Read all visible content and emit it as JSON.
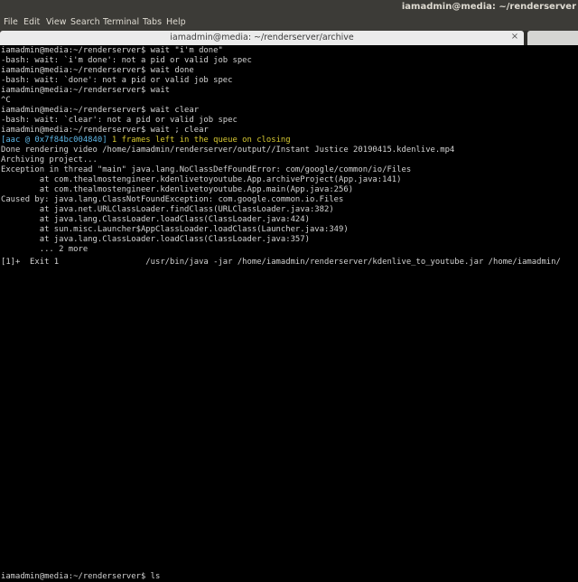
{
  "topbar": {
    "title": "iamadmin@media: ~/renderserver"
  },
  "menu": [
    "File",
    "Edit",
    "View",
    "Search",
    "Terminal",
    "Tabs",
    "Help"
  ],
  "tab": {
    "title": "iamadmin@media: ~/renderserver/archive",
    "close_glyph": "×"
  },
  "terminal": {
    "lines": [
      "iamadmin@media:~/renderserver$ wait \"i'm done\"",
      "-bash: wait: `i'm done': not a pid or valid job spec",
      "iamadmin@media:~/renderserver$ wait done",
      "-bash: wait: `done': not a pid or valid job spec",
      "iamadmin@media:~/renderserver$ wait",
      "^C",
      "iamadmin@media:~/renderserver$ wait clear",
      "-bash: wait: `clear': not a pid or valid job spec",
      "iamadmin@media:~/renderserver$ wait ; clear",
      "",
      "Done rendering video /home/iamadmin/renderserver/output//Instant Justice 20190415.kdenlive.mp4",
      "Archiving project...",
      "Exception in thread \"main\" java.lang.NoClassDefFoundError: com/google/common/io/Files",
      "        at com.thealmostengineer.kdenlivetoyoutube.App.archiveProject(App.java:141)",
      "        at com.thealmostengineer.kdenlivetoyoutube.App.main(App.java:256)",
      "Caused by: java.lang.ClassNotFoundException: com.google.common.io.Files",
      "        at java.net.URLClassLoader.findClass(URLClassLoader.java:382)",
      "        at java.lang.ClassLoader.loadClass(ClassLoader.java:424)",
      "        at sun.misc.Launcher$AppClassLoader.loadClass(Launcher.java:349)",
      "        at java.lang.ClassLoader.loadClass(ClassLoader.java:357)",
      "        ... 2 more",
      "[1]+  Exit 1                  /usr/bin/java -jar /home/iamadmin/renderserver/kdenlive_to_youtube.jar /home/iamadmin/"
    ],
    "aac_line": {
      "prefix": "[aac @ 0x7f84bc004840]",
      "message": " 1 frames left in the queue on closing"
    },
    "bottom_prompt": "iamadmin@media:~/renderserver$ ls"
  },
  "colors": {
    "terminal_bg": "#000000",
    "terminal_text": "#d3d3d3",
    "aac_prefix": "#5fb7e6",
    "aac_message": "#d6c832",
    "ubuntu_panel": "#3c3b37"
  }
}
